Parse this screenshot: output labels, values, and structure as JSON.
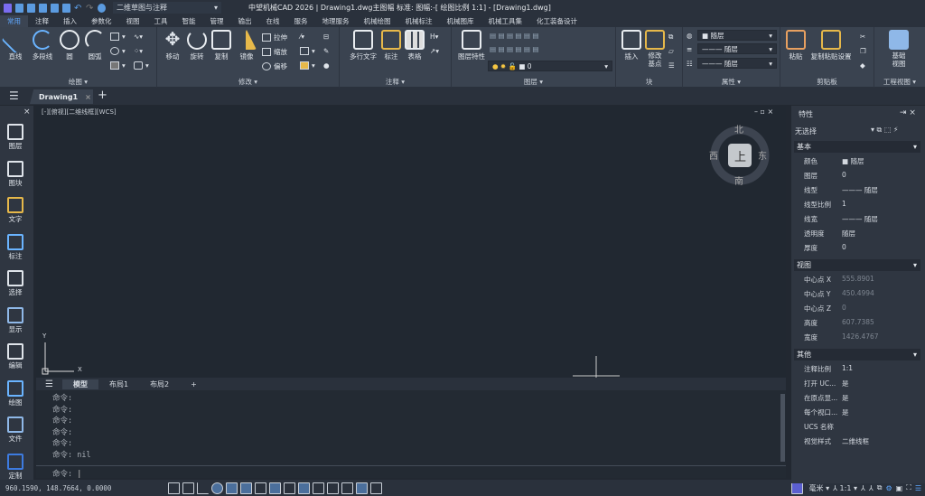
{
  "titlebar": {
    "workspace": "二维草图与注释",
    "title": "中望机械CAD 2026 | Drawing1.dwg主图幅  标准: 图幅:-[ 绘图比例 1:1] - [Drawing1.dwg]"
  },
  "menu": [
    "常用",
    "注释",
    "插入",
    "参数化",
    "视图",
    "工具",
    "智能",
    "管理",
    "输出",
    "在线",
    "服务",
    "地理服务",
    "机械绘图",
    "机械标注",
    "机械图库",
    "机械工具集",
    "化工装备设计"
  ],
  "ribbon": {
    "draw": {
      "label": "绘图",
      "tools": [
        "直线",
        "多段线",
        "圆",
        "圆弧"
      ]
    },
    "modify": {
      "label": "修改",
      "tools": [
        "移动",
        "旋转",
        "复制",
        "镜像"
      ],
      "small": [
        "拉伸",
        "缩放",
        "偏移"
      ]
    },
    "annotate": {
      "label": "注释",
      "tools": [
        "多行文字",
        "标注",
        "表格"
      ]
    },
    "layers": {
      "label": "图层",
      "tool": "图层特性",
      "current_layer": "0"
    },
    "block": {
      "label": "块",
      "tools": [
        "插入",
        "修改\n基点"
      ]
    },
    "properties": {
      "label": "属性",
      "color": "随层",
      "linetype": "随层",
      "lineweight": "随层"
    },
    "clipboard": {
      "label": "剪贴板",
      "tools": [
        "粘贴",
        "复制粘贴设置"
      ]
    },
    "engview": {
      "label": "工程视图",
      "tools": [
        "基础\n视图"
      ]
    }
  },
  "doc": {
    "tab": "Drawing1",
    "view_label": "[-][俯视][二维线框][WCS]"
  },
  "left_toolbar": [
    "图层",
    "图块",
    "文字",
    "标注",
    "选择",
    "显示",
    "编辑",
    "绘图",
    "文件",
    "定制"
  ],
  "viewcube": {
    "top": "上",
    "north": "北",
    "south": "南",
    "east": "东",
    "west": "西"
  },
  "ucs": {
    "x": "X",
    "y": "Y"
  },
  "layout_tabs": [
    "模型",
    "布局1",
    "布局2",
    "+"
  ],
  "command": {
    "history": [
      "命令:",
      "命令:",
      "命令:",
      "命令:",
      "命令:",
      "命令: nil"
    ],
    "prompt": "命令:"
  },
  "status": {
    "coords": "960.1590, 148.7664, 0.0000",
    "units": "毫米",
    "scale": "1:1"
  },
  "properties": {
    "title": "特性",
    "selection": "无选择",
    "sections": [
      {
        "name": "基本",
        "rows": [
          [
            "颜色",
            "■ 随层"
          ],
          [
            "图层",
            "0"
          ],
          [
            "线型",
            "——— 随层"
          ],
          [
            "线型比例",
            "1"
          ],
          [
            "线宽",
            "——— 随层"
          ],
          [
            "透明度",
            "随层"
          ],
          [
            "厚度",
            "0"
          ]
        ]
      },
      {
        "name": "视图",
        "rows": [
          [
            "中心点 X",
            "555.8901"
          ],
          [
            "中心点 Y",
            "450.4994"
          ],
          [
            "中心点 Z",
            "0"
          ],
          [
            "高度",
            "607.7385"
          ],
          [
            "宽度",
            "1426.4767"
          ]
        ]
      },
      {
        "name": "其他",
        "rows": [
          [
            "注释比例",
            "1:1"
          ],
          [
            "打开 UC...",
            "是"
          ],
          [
            "在原点显...",
            "是"
          ],
          [
            "每个视口...",
            "是"
          ],
          [
            "UCS 名称",
            ""
          ],
          [
            "视觉样式",
            "二维线框"
          ]
        ]
      }
    ]
  },
  "colors": {
    "accent": "#5fa8ff",
    "canvas": "#212831",
    "ribbon": "#3a4350"
  }
}
